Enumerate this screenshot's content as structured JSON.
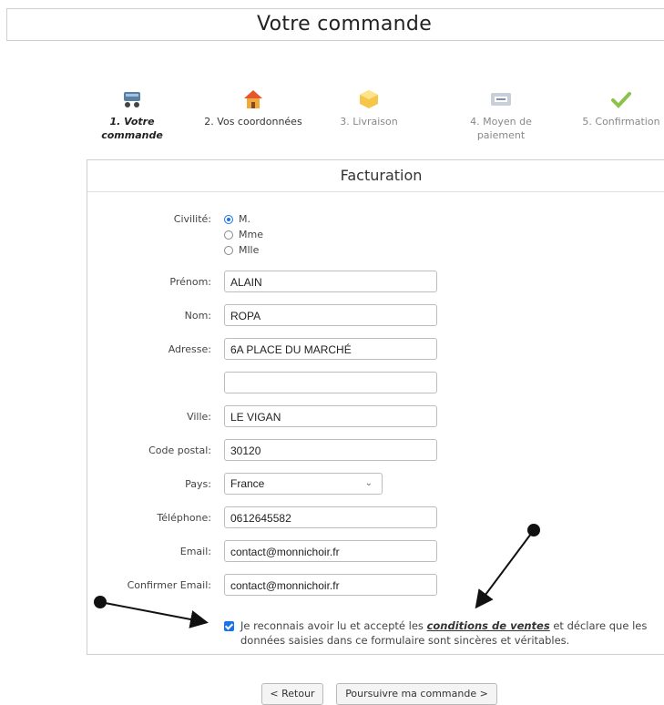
{
  "page": {
    "title": "Votre commande"
  },
  "steps": [
    {
      "label": "1. Votre commande",
      "icon": "shopping-cart-icon",
      "state": "active"
    },
    {
      "label": "2. Vos coordonnées",
      "icon": "house-icon",
      "state": "current"
    },
    {
      "label": "3. Livraison",
      "icon": "package-icon",
      "state": "pending"
    },
    {
      "label": "4. Moyen de paiement",
      "icon": "credit-card-icon",
      "state": "pending"
    },
    {
      "label": "5. Confirmation",
      "icon": "checkmark-icon",
      "state": "pending"
    }
  ],
  "billing": {
    "heading": "Facturation",
    "civility_label": "Civilité:",
    "civility_options": [
      "M.",
      "Mme",
      "Mlle"
    ],
    "civility_selected": "M.",
    "prenom_label": "Prénom:",
    "prenom_value": "ALAIN",
    "nom_label": "Nom:",
    "nom_value": "ROPA",
    "adresse_label": "Adresse:",
    "adresse_value": "6A PLACE DU MARCHÉ",
    "adresse2_value": "",
    "ville_label": "Ville:",
    "ville_value": "LE VIGAN",
    "cp_label": "Code postal:",
    "cp_value": "30120",
    "pays_label": "Pays:",
    "pays_value": "France",
    "tel_label": "Téléphone:",
    "tel_value": "0612645582",
    "email_label": "Email:",
    "email_value": "contact@monnichoir.fr",
    "email2_label": "Confirmer Email:",
    "email2_value": "contact@monnichoir.fr",
    "consent_checked": true,
    "consent_before": "Je reconnais avoir lu et accepté les ",
    "consent_link": "conditions de ventes",
    "consent_after": " et déclare que les données saisies dans ce formulaire sont sincères et véritables."
  },
  "buttons": {
    "back": "< Retour",
    "next": "Poursuivre ma commande >"
  },
  "colors": {
    "accent": "#1a73e8",
    "checkmark": "#8bc34a"
  }
}
